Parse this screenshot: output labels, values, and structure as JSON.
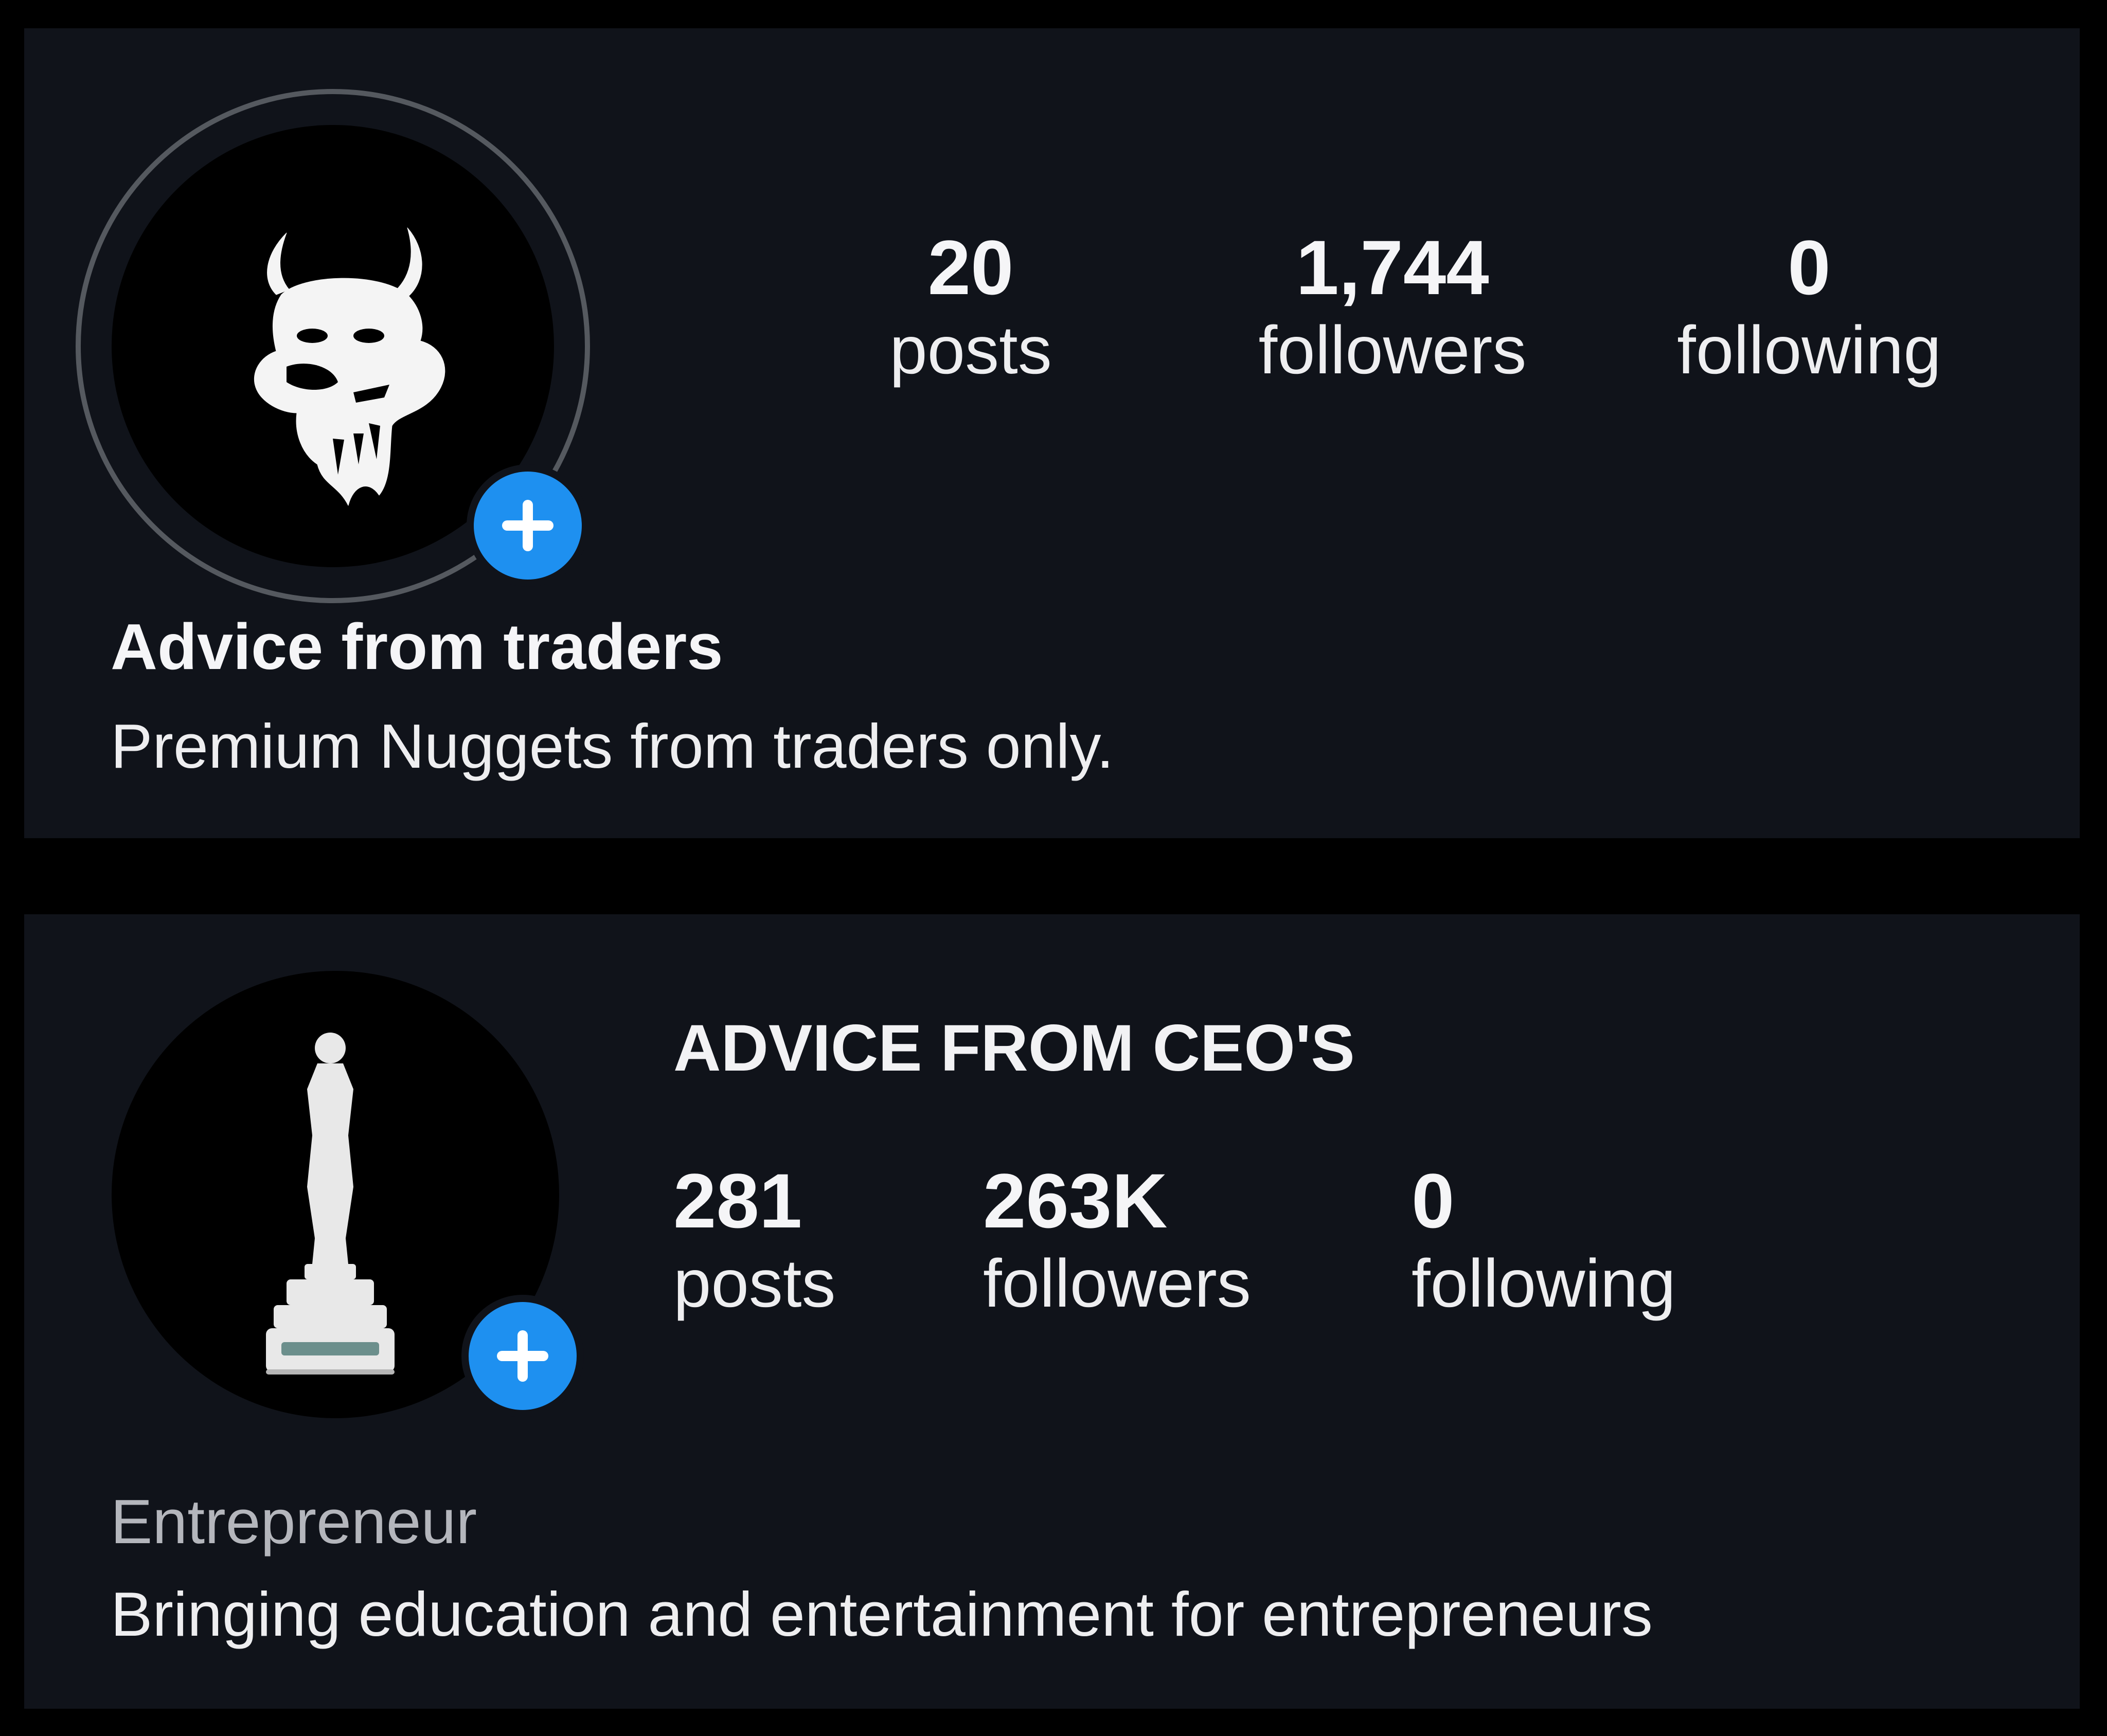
{
  "profiles": [
    {
      "display_name": "Advice from traders",
      "bio": "Premium Nuggets from traders only.",
      "avatar_icon": "bull-logo-icon",
      "badge_icon": "add-story-plus-icon",
      "stats": {
        "posts": {
          "value": "20",
          "label": "posts"
        },
        "followers": {
          "value": "1,744",
          "label": "followers"
        },
        "following": {
          "value": "0",
          "label": "following"
        }
      }
    },
    {
      "display_name": "ADVICE FROM CEO'S",
      "category": "Entrepreneur",
      "bio": "Bringing education and entertainment for entrepreneurs",
      "avatar_icon": "trophy-statue-icon",
      "badge_icon": "add-story-plus-icon",
      "stats": {
        "posts": {
          "value": "281",
          "label": "posts"
        },
        "followers": {
          "value": "263K",
          "label": "followers"
        },
        "following": {
          "value": "0",
          "label": "following"
        }
      }
    }
  ],
  "colors": {
    "background": "#000000",
    "card": "#10131a",
    "badge": "#1e90f0",
    "text": "#f2f2f4",
    "muted_text": "#b4b6bc",
    "ring": "#55595f"
  }
}
